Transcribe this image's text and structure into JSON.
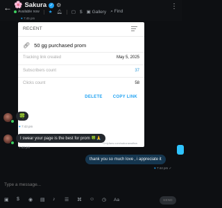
{
  "header": {
    "back_icon": "arrow-left",
    "flower_icon": "🌸",
    "title": "Sakura",
    "more_icon": "⋮"
  },
  "toolbar": {
    "status": "Available now",
    "gallery": "Gallery",
    "find": "Find"
  },
  "messages": {
    "first_time": "7:45 pm",
    "reaction_time": "7:43 pm",
    "in_message": "I swear your page is the best for prom 🍀🙏",
    "in_time": "7:43 pm",
    "out_message": "thank you so much love , i appreciate it",
    "out_time": "7:44 pm",
    "reaction_emoji": "🍀"
  },
  "card": {
    "header": "RECENT",
    "link_name": "50 gg purchased prom",
    "rows": [
      {
        "label": "Tracking link created",
        "value": "May 5, 2025"
      },
      {
        "label": "Subscribers count",
        "value": "37"
      },
      {
        "label": "Clicks count",
        "value": "58"
      }
    ],
    "delete_label": "DELETE",
    "copy_label": "COPY LINK",
    "footer": "Onlyfans.com/sakurawaifsw"
  },
  "composer": {
    "placeholder": "Type a message...",
    "send_label": "SEND"
  },
  "colors": {
    "accent": "#1da1f2",
    "online": "#3ecf60",
    "outgoing_bubble": "#15364f",
    "incoming_bubble": "#23272c"
  }
}
